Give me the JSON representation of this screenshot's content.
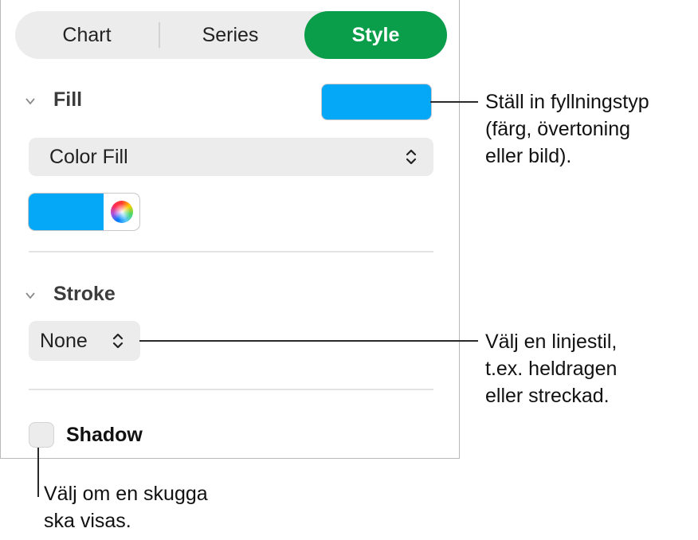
{
  "tabs": [
    {
      "label": "Chart",
      "selected": false
    },
    {
      "label": "Series",
      "selected": false
    },
    {
      "label": "Style",
      "selected": true
    }
  ],
  "fill": {
    "section_label": "Fill",
    "swatch_color": "#05A7F7",
    "type_value": "Color Fill",
    "well_color": "#05A7F7"
  },
  "stroke": {
    "section_label": "Stroke",
    "type_value": "None"
  },
  "shadow": {
    "label": "Shadow",
    "checked": false
  },
  "callouts": {
    "fill": [
      "Ställ in fyllningstyp",
      "(färg, övertoning",
      "eller bild)."
    ],
    "stroke": [
      "Välj en linjestil,",
      "t.ex. heldragen",
      "eller streckad."
    ],
    "shadow": [
      "Välj om en skugga",
      "ska visas."
    ]
  },
  "colors": {
    "accent": "#0A9E4B",
    "fill_swatch": "#05A7F7"
  },
  "icons": [
    "chevron-down-icon",
    "up-down-arrows-icon",
    "color-wheel-icon"
  ]
}
